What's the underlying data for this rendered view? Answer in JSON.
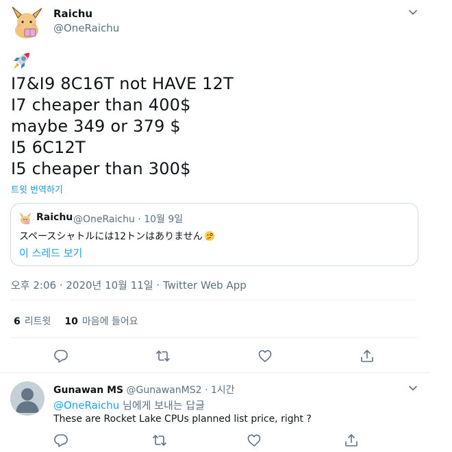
{
  "tweet": {
    "author_name": "Raichu",
    "author_handle": "@OneRaichu",
    "lines": [
      "I7&I9 8C16T not HAVE 12T",
      "I7 cheaper than 400$",
      "maybe 349 or 379 $",
      "I5 6C12T",
      "I5 cheaper than 300$"
    ],
    "translate_label": "트윗 번역하기",
    "timestamp": "오후 2:06 · 2020년 10월 11일 · Twitter Web App"
  },
  "quote": {
    "author_name": "Raichu",
    "meta": "@OneRaichu · 10월 9일",
    "text": "スペースシャトルには12トンはありません",
    "thread_link": "이 스레드 보기"
  },
  "stats": {
    "retweets_count": "6",
    "retweets_label": "리트윗",
    "likes_count": "10",
    "likes_label": "마음에 들어요"
  },
  "reply": {
    "author_name": "Gunawan MS",
    "meta": " @GunawanMS2 · 1시간",
    "replying_to_mention": "@OneRaichu",
    "replying_to_suffix": " 님에게 보내는 답글",
    "text": "These are Rocket Lake CPUs planned list price, right ?"
  },
  "icons": [
    "chevron-down-icon",
    "rocket-icon",
    "reply-icon",
    "retweet-icon",
    "like-icon",
    "share-icon",
    "thinking-face-icon"
  ],
  "colors": {
    "accent": "#1da1f2",
    "secondary_text": "#5b7083",
    "divider": "#ebeef0"
  }
}
